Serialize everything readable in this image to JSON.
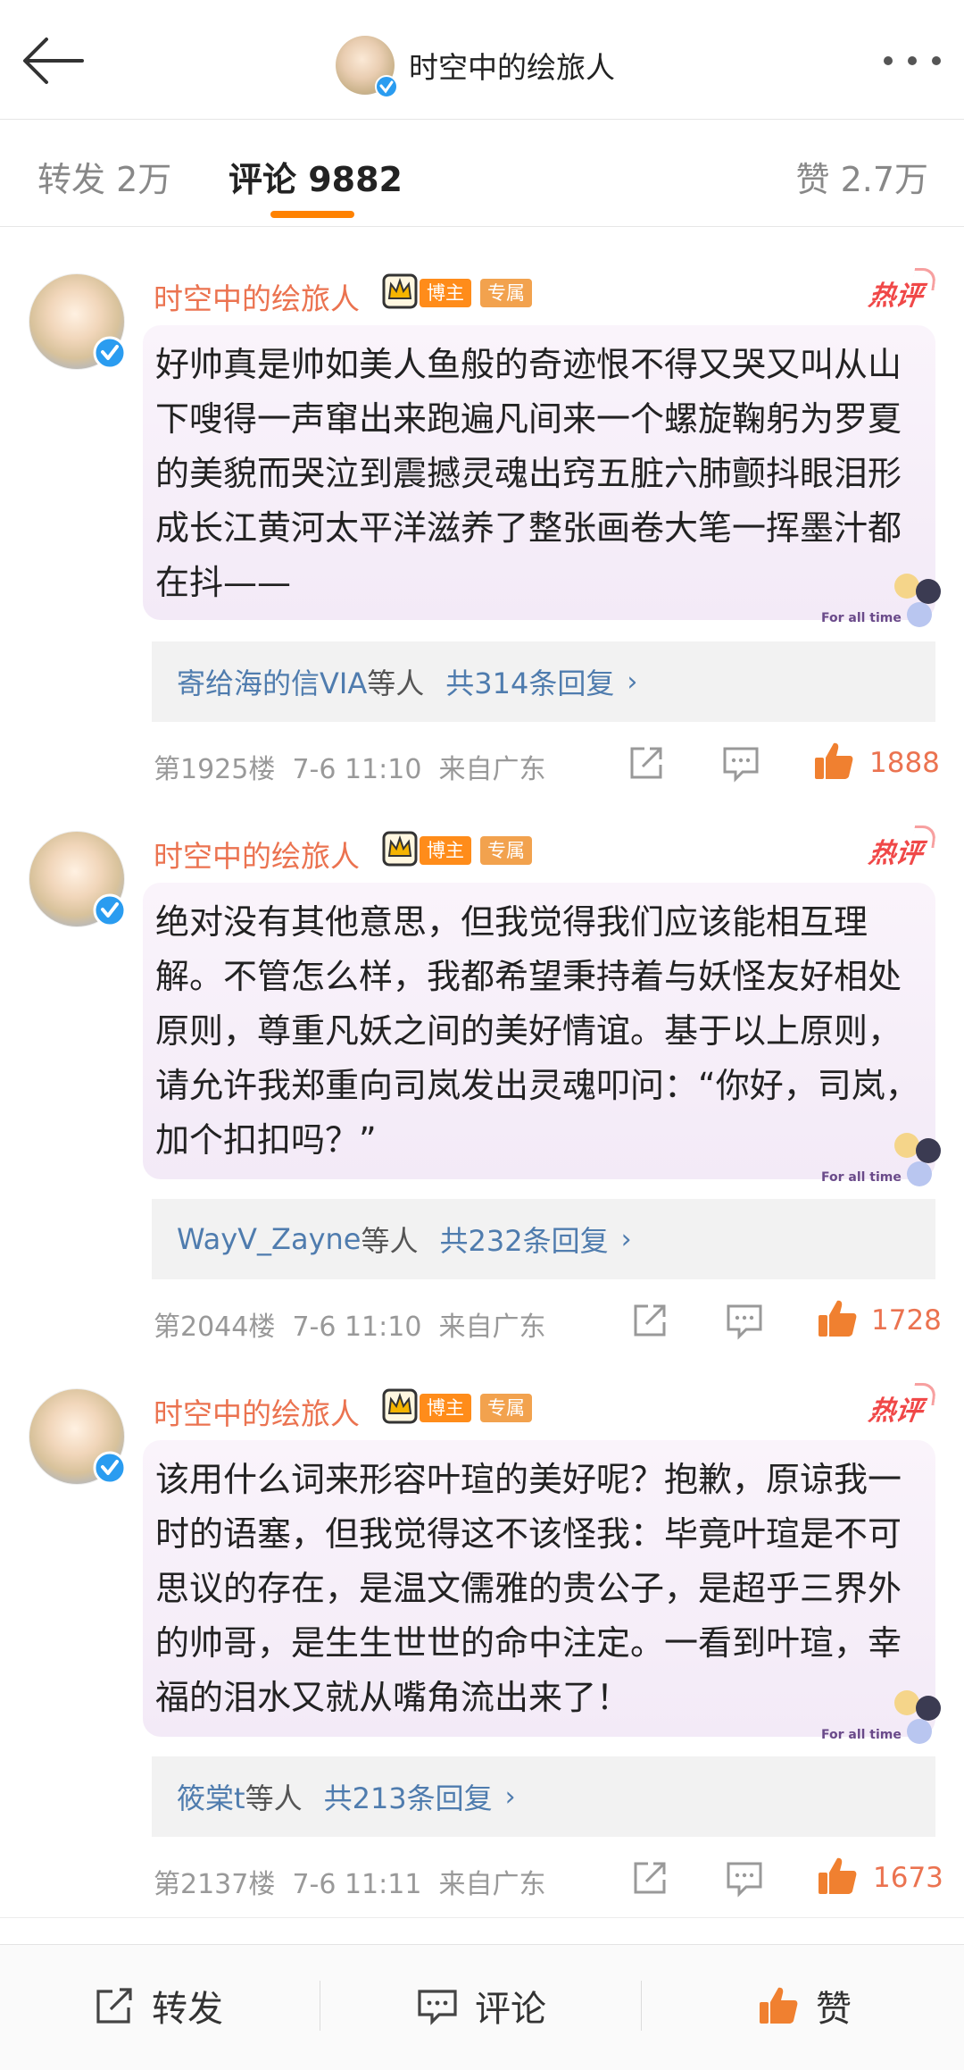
{
  "header": {
    "title": "时空中的绘旅人"
  },
  "tabs": {
    "repost": "转发 2万",
    "comment": "评论 9882",
    "like": "赞 2.7万"
  },
  "badges": {
    "host": "博主",
    "exclusive": "专属",
    "hot": "热评",
    "sticker_text": "For all time"
  },
  "comments": [
    {
      "username": "时空中的绘旅人",
      "text": "好帅真是帅如美人鱼般的奇迹恨不得又哭又叫从山下嗖得一声窜出来跑遍凡间来一个螺旋鞠躬为罗夏的美貌而哭泣到震撼灵魂出窍五脏六肺颤抖眼泪形成长江黄河太平洋滋养了整张画卷大笔一挥墨汁都在抖——",
      "reply_users": "寄给海的信VIA",
      "reply_users_suffix": "等人",
      "reply_count": "共314条回复",
      "floor": "第1925楼",
      "time": "7-6 11:10",
      "location": "来自广东",
      "likes": "1888"
    },
    {
      "username": "时空中的绘旅人",
      "text": "绝对没有其他意思，但我觉得我们应该能相互理解。不管怎么样，我都希望秉持着与妖怪友好相处原则，尊重凡妖之间的美好情谊。基于以上原则，请允许我郑重向司岚发出灵魂叩问：“你好，司岚，加个扣扣吗？”",
      "reply_users": "WayV_Zayne",
      "reply_users_suffix": "等人",
      "reply_count": "共232条回复",
      "floor": "第2044楼",
      "time": "7-6 11:10",
      "location": "来自广东",
      "likes": "1728"
    },
    {
      "username": "时空中的绘旅人",
      "text": "该用什么词来形容叶瑄的美好呢？抱歉，原谅我一时的语塞，但我觉得这不该怪我：毕竟叶瑄是不可思议的存在，是温文儒雅的贵公子，是超乎三界外的帅哥，是生生世世的命中注定。一看到叶瑄，幸福的泪水又就从嘴角流出来了！",
      "reply_users": "筱棠t",
      "reply_users_suffix": "等人",
      "reply_count": "共213条回复",
      "floor": "第2137楼",
      "time": "7-6 11:11",
      "location": "来自广东",
      "likes": "1673"
    }
  ],
  "bottom_bar": {
    "repost": "转发",
    "comment": "评论",
    "like": "赞"
  },
  "colors": {
    "accent": "#ff8200",
    "username": "#eb7350",
    "link": "#4f7cae",
    "hot": "#f04848"
  },
  "icons": {
    "back": "back-arrow-icon",
    "more": "more-dots-icon",
    "verified": "verified-icon",
    "crown": "crown-icon",
    "share": "share-icon",
    "comment": "comment-icon",
    "like": "thumbs-up-icon"
  }
}
